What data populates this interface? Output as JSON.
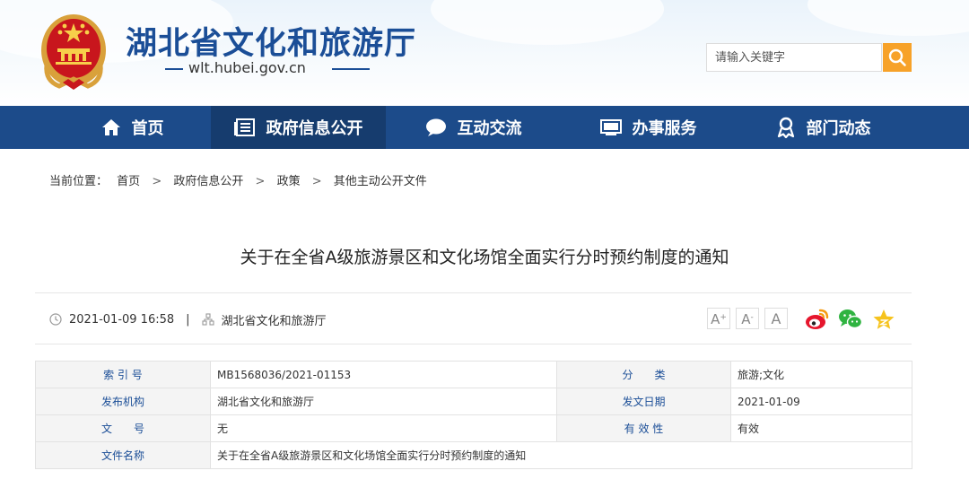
{
  "header": {
    "site_title": "湖北省文化和旅游厅",
    "domain": "wlt.hubei.gov.cn",
    "emblem_icon": "national-emblem-icon",
    "search": {
      "placeholder": "请输入关键字",
      "icon": "search-icon"
    }
  },
  "nav": {
    "items": [
      {
        "label": "首页",
        "icon": "home-icon"
      },
      {
        "label": "政府信息公开",
        "icon": "document-list-icon",
        "active": true
      },
      {
        "label": "互动交流",
        "icon": "chat-bubble-icon"
      },
      {
        "label": "办事服务",
        "icon": "monitor-icon"
      },
      {
        "label": "部门动态",
        "icon": "award-icon"
      }
    ]
  },
  "breadcrumb": {
    "prefix": "当前位置：",
    "separator": ">",
    "items": [
      "首页",
      "政府信息公开",
      "政策",
      "其他主动公开文件"
    ]
  },
  "article": {
    "title": "关于在全省A级旅游景区和文化场馆全面实行分时预约制度的通知",
    "datetime": "2021-01-09 16:58",
    "divider": "|",
    "source": "湖北省文化和旅游厅",
    "font_sizes": [
      "A",
      "A",
      "A"
    ],
    "share_icons": [
      "weibo-icon",
      "wechat-icon",
      "favorite-star-icon"
    ]
  },
  "info_table": {
    "rows": [
      {
        "k1": "索 引 号",
        "v1": "MB1568036/2021-01153",
        "k2": "分　　类",
        "v2": "旅游;文化"
      },
      {
        "k1": "发布机构",
        "v1": "湖北省文化和旅游厅",
        "k2": "发文日期",
        "v2": "2021-01-09"
      },
      {
        "k1": "文　　号",
        "v1": "无",
        "k2": "有 效 性",
        "v2": "有效"
      },
      {
        "k1": "文件名称",
        "v1": "关于在全省A级旅游景区和文化场馆全面实行分时预约制度的通知"
      }
    ]
  },
  "colors": {
    "brand_blue": "#1b4e97",
    "nav_bg": "#1c4b8a",
    "nav_active": "#163c6e",
    "search_button": "#f7a229"
  }
}
